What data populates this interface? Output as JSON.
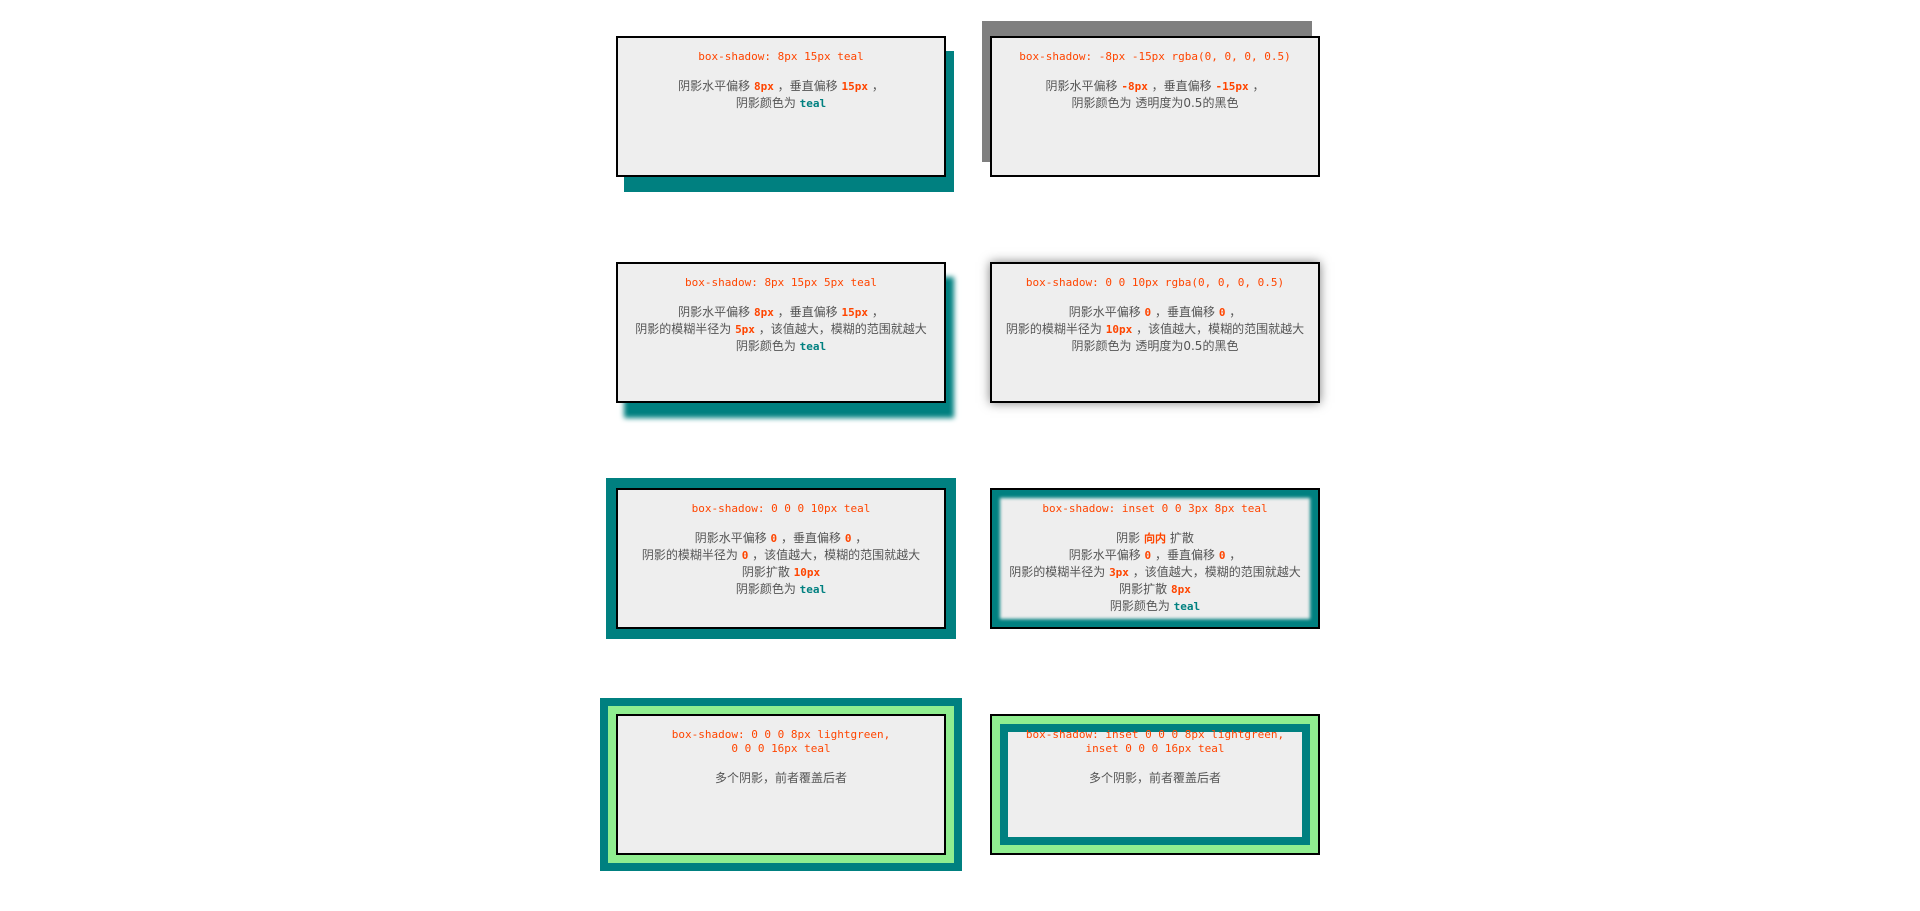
{
  "boxes": [
    {
      "code": "box-shadow: 8px 15px teal",
      "lines": [
        [
          "阴影水平偏移 ",
          "8px",
          " ，垂直偏移 ",
          "15px",
          " ，"
        ],
        [
          "阴影颜色为 ",
          "teal"
        ]
      ]
    },
    {
      "code": "box-shadow: -8px -15px rgba(0, 0, 0, 0.5)",
      "lines": [
        [
          "阴影水平偏移 ",
          "-8px",
          " ，垂直偏移 ",
          "-15px",
          " ，"
        ],
        [
          "阴影颜色为 透明度为0.5的黑色"
        ]
      ]
    },
    {
      "code": "box-shadow: 8px 15px 5px teal",
      "lines": [
        [
          "阴影水平偏移 ",
          "8px",
          " ，垂直偏移 ",
          "15px",
          " ，"
        ],
        [
          "阴影的模糊半径为 ",
          "5px",
          " ，该值越大，模糊的范围就越大"
        ],
        [
          "阴影颜色为 ",
          "teal"
        ]
      ]
    },
    {
      "code": "box-shadow: 0 0 10px rgba(0, 0, 0, 0.5)",
      "lines": [
        [
          "阴影水平偏移 ",
          "0",
          " ，垂直偏移 ",
          "0",
          " ，"
        ],
        [
          "阴影的模糊半径为 ",
          "10px",
          " ，该值越大，模糊的范围就越大"
        ],
        [
          "阴影颜色为 透明度为0.5的黑色"
        ]
      ]
    },
    {
      "code": "box-shadow: 0 0 0 10px teal",
      "lines": [
        [
          "阴影水平偏移 ",
          "0",
          " ，垂直偏移 ",
          "0",
          " ，"
        ],
        [
          "阴影的模糊半径为 ",
          "0",
          " ，该值越大，模糊的范围就越大"
        ],
        [
          "阴影扩散 ",
          "10px"
        ],
        [
          "阴影颜色为 ",
          "teal"
        ]
      ]
    },
    {
      "code": "box-shadow: inset 0 0 3px 8px teal",
      "lines": [
        [
          "阴影 ",
          "向内",
          " 扩散"
        ],
        [
          "阴影水平偏移 ",
          "0",
          " ，垂直偏移 ",
          "0",
          " ，"
        ],
        [
          "阴影的模糊半径为 ",
          "3px",
          " ，该值越大，模糊的范围就越大"
        ],
        [
          "阴影扩散 ",
          "8px"
        ],
        [
          "阴影颜色为 ",
          "teal"
        ]
      ]
    },
    {
      "code": "box-shadow: 0 0 0 8px lightgreen,\n0 0 0 16px teal",
      "lines": [
        [
          "多个阴影，前者覆盖后者"
        ]
      ]
    },
    {
      "code": "box-shadow: inset 0 0 0 8px lightgreen,\ninset 0 0 0 16px teal",
      "lines": [
        [
          "多个阴影，前者覆盖后者"
        ]
      ]
    }
  ]
}
